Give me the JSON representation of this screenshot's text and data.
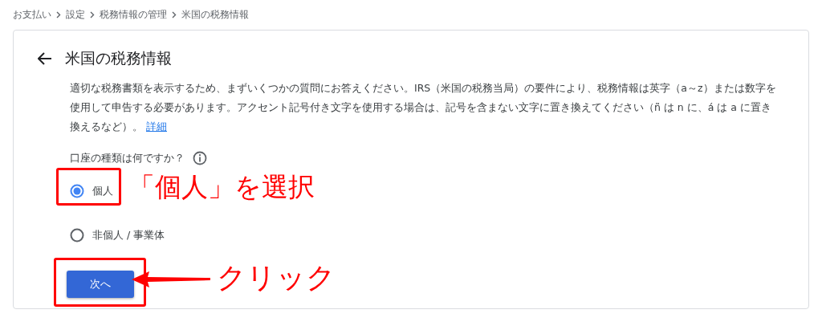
{
  "breadcrumb": [
    "お支払い",
    "設定",
    "税務情報の管理",
    "米国の税務情報"
  ],
  "card": {
    "title": "米国の税務情報",
    "description": "適切な税務書類を表示するため、まずいくつかの質問にお答えください。IRS（米国の税務当局）の要件により、税務情報は英字（a～z）または数字を使用して申告する必要があります。アクセント記号付き文字を使用する場合は、記号を含まない文字に置き換えてください（ñ は n に、á は a に置き換えるなど）。",
    "link": "詳細",
    "question": "口座の種類は何ですか？",
    "options": [
      {
        "label": "個人",
        "selected": true
      },
      {
        "label": "非個人 / 事業体",
        "selected": false
      }
    ],
    "button": "次へ"
  },
  "annotations": [
    {
      "kind": "highlight"
    },
    {
      "kind": "callout",
      "text": "「個人」を選択"
    },
    {
      "kind": "highlight"
    },
    {
      "kind": "arrow-callout",
      "text": "クリック"
    }
  ]
}
